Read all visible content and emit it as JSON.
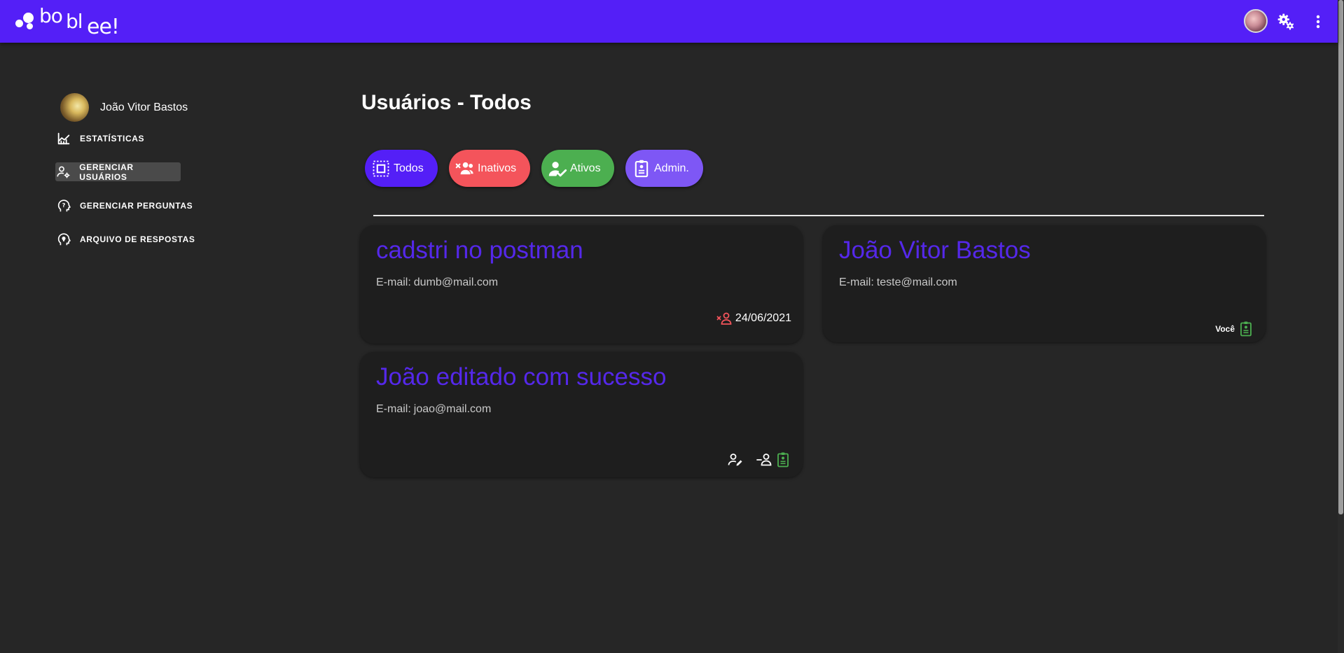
{
  "app": {
    "brand": {
      "part1": "bo",
      "part2": "bl",
      "part3": "ee!"
    }
  },
  "topbar": {
    "avatar_icon": "user-avatar",
    "settings_icon": "gears-icon",
    "menu_icon": "more-vert-icon"
  },
  "sidebar": {
    "user_name": "João Vitor Bastos",
    "items": [
      {
        "label": "ESTATÍSTICAS",
        "icon": "stats-chart-icon",
        "active": false
      },
      {
        "label": "GERENCIAR USUÁRIOS",
        "icon": "manage-users-icon",
        "active": true
      },
      {
        "label": "GERENCIAR PERGUNTAS",
        "icon": "head-question-icon",
        "active": false
      },
      {
        "label": "ARQUIVO DE RESPOSTAS",
        "icon": "head-bulb-icon",
        "active": false
      }
    ]
  },
  "main": {
    "title": "Usuários - Todos",
    "filters": [
      {
        "label": "Todos",
        "icon": "select-all-icon",
        "color": "#541ff7"
      },
      {
        "label": "Inativos",
        "icon": "group-remove-icon",
        "color": "#f4545b"
      },
      {
        "label": "Ativos",
        "icon": "person-check-icon",
        "color": "#4caf50"
      },
      {
        "label": "Admin.",
        "icon": "badge-icon",
        "color": "#7e57f5"
      }
    ],
    "email_label": "E-mail:",
    "users": [
      {
        "name": "cadstri no postman",
        "email": "dumb@mail.com",
        "date": "24/06/2021",
        "status_icon": "person-remove-icon"
      },
      {
        "name": "João Vitor Bastos",
        "email": "teste@mail.com",
        "badge": "Você",
        "status_icon": "badge-icon"
      },
      {
        "name": "João editado com sucesso",
        "email": "joao@mail.com",
        "actions": [
          "edit-user-icon",
          "remove-user-icon",
          "badge-icon"
        ]
      }
    ]
  },
  "colors": {
    "brand": "#541ff7",
    "inactive": "#f4545b",
    "active": "#4caf50",
    "admin": "#7e57f5",
    "card_title": "#5528ea"
  }
}
